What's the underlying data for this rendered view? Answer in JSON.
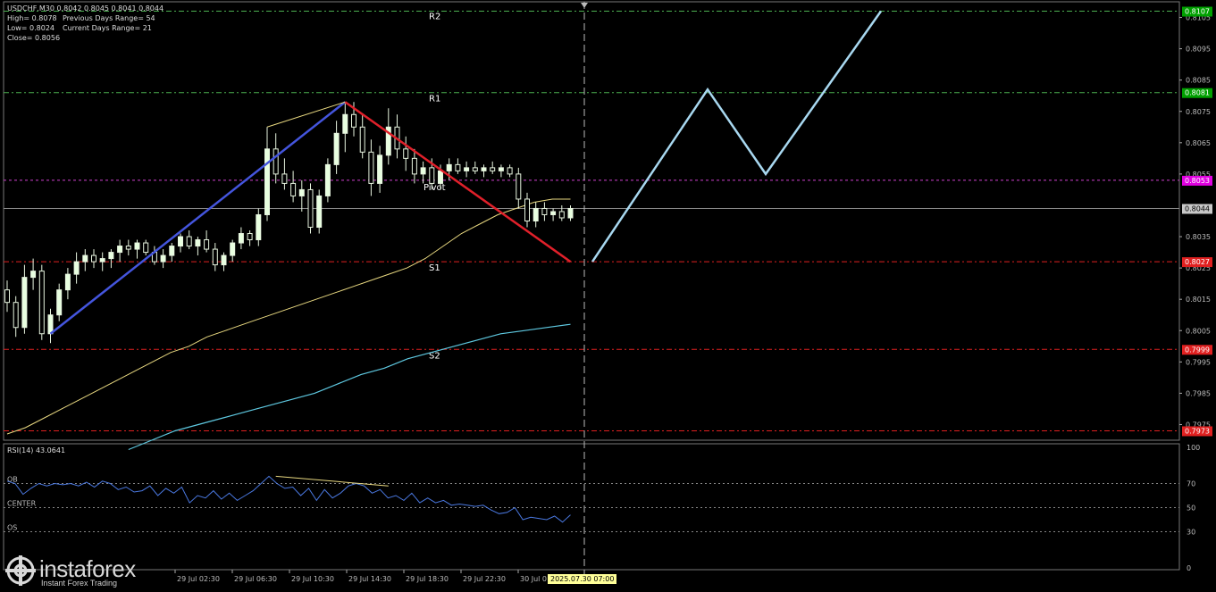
{
  "header": {
    "symbol": "USDCHF,M30",
    "ohlc": "0.8042 0.8045 0.8041 0.8044",
    "high": "High= 0.8078",
    "low": "Low= 0.8024",
    "close": "Close= 0.8056",
    "prev_range": "Previous Days Range= 54",
    "cur_range": "Current Days Range= 21"
  },
  "levels": [
    {
      "id": "R2",
      "label": "R2",
      "value": 0.8107,
      "tag": "0.8107",
      "tag_color": "#00a000",
      "line_color": "#4caf50"
    },
    {
      "id": "R1",
      "label": "R1",
      "value": 0.8081,
      "tag": "0.8081",
      "tag_color": "#00a000",
      "line_color": "#4caf50"
    },
    {
      "id": "Pivot",
      "label": "Pivot",
      "value": 0.8053,
      "tag": "0.8053",
      "tag_color": "#e000e0",
      "line_color": "#d040d0"
    },
    {
      "id": "current",
      "label": "",
      "value": 0.8044,
      "tag": "0.8044",
      "tag_color": "#c8c8c8",
      "line_color": "#888888"
    },
    {
      "id": "S1",
      "label": "S1",
      "value": 0.8027,
      "tag": "0.8027",
      "tag_color": "#e02020",
      "line_color": "#e02020"
    },
    {
      "id": "S2",
      "label": "S2",
      "value": 0.7999,
      "tag": "0.7999",
      "tag_color": "#e02020",
      "line_color": "#e02020"
    },
    {
      "id": "S3",
      "label": "",
      "value": 0.7973,
      "tag": "0.7973",
      "tag_color": "#e02020",
      "line_color": "#e02020"
    }
  ],
  "price_axis": [
    "0.8105",
    "0.8095",
    "0.8085",
    "0.8075",
    "0.8065",
    "0.8055",
    "0.8035",
    "0.8025",
    "0.8015",
    "0.8005",
    "0.7995",
    "0.7985",
    "0.7975"
  ],
  "rsi": {
    "label": "RSI(14) 43.0641",
    "axis": [
      "100",
      "70",
      "50",
      "30",
      "0"
    ],
    "level_labels": {
      "ob": "OB",
      "center": "CENTER",
      "os": "OS"
    },
    "values": [
      72,
      70,
      61,
      66,
      70,
      68,
      70,
      69,
      70,
      68,
      71,
      67,
      72,
      70,
      65,
      67,
      63,
      64,
      68,
      60,
      66,
      62,
      67,
      54,
      60,
      58,
      64,
      57,
      62,
      56,
      60,
      64,
      70,
      76,
      70,
      66,
      67,
      60,
      66,
      56,
      65,
      58,
      62,
      68,
      70,
      68,
      62,
      65,
      58,
      60,
      56,
      62,
      54,
      58,
      54,
      56,
      52,
      53,
      52,
      51,
      52,
      48,
      45,
      46,
      50,
      40,
      42,
      41,
      40,
      43,
      38,
      44
    ]
  },
  "time_axis": [
    "29 Jul 02:30",
    "29 Jul 06:30",
    "29 Jul 10:30",
    "29 Jul 14:30",
    "29 Jul 18:30",
    "29 Jul 22:30",
    "30 Jul 0"
  ],
  "time_cursor": "2025.07.30 07:00",
  "brand": {
    "name": "instaforex",
    "tagline": "Instant Forex Trading"
  },
  "chart_data": {
    "type": "candlestick",
    "symbol": "USDCHF",
    "timeframe": "M30",
    "ylim": [
      0.797,
      0.811
    ],
    "candles": [
      [
        0.8018,
        0.8021,
        0.8011,
        0.8014
      ],
      [
        0.8014,
        0.8016,
        0.8003,
        0.8006
      ],
      [
        0.8006,
        0.8026,
        0.8004,
        0.8022
      ],
      [
        0.8022,
        0.8028,
        0.8018,
        0.8024
      ],
      [
        0.8024,
        0.8026,
        0.8002,
        0.8004
      ],
      [
        0.8004,
        0.8012,
        0.8001,
        0.801
      ],
      [
        0.801,
        0.802,
        0.8008,
        0.8018
      ],
      [
        0.8018,
        0.8025,
        0.8015,
        0.8023
      ],
      [
        0.8023,
        0.803,
        0.802,
        0.8027
      ],
      [
        0.8027,
        0.8031,
        0.8024,
        0.8029
      ],
      [
        0.8029,
        0.8031,
        0.8025,
        0.8027
      ],
      [
        0.8027,
        0.803,
        0.8024,
        0.8028
      ],
      [
        0.8028,
        0.8031,
        0.8025,
        0.803
      ],
      [
        0.803,
        0.8034,
        0.8027,
        0.8032
      ],
      [
        0.8032,
        0.8034,
        0.8029,
        0.8031
      ],
      [
        0.8031,
        0.8034,
        0.8028,
        0.8033
      ],
      [
        0.8033,
        0.8034,
        0.8029,
        0.803
      ],
      [
        0.803,
        0.8032,
        0.8026,
        0.8027
      ],
      [
        0.8027,
        0.8031,
        0.8025,
        0.8029
      ],
      [
        0.8029,
        0.8033,
        0.8027,
        0.8032
      ],
      [
        0.8032,
        0.8036,
        0.803,
        0.8035
      ],
      [
        0.8035,
        0.8037,
        0.8031,
        0.8032
      ],
      [
        0.8032,
        0.8035,
        0.8029,
        0.8034
      ],
      [
        0.8034,
        0.8037,
        0.803,
        0.8031
      ],
      [
        0.8031,
        0.8033,
        0.8024,
        0.8026
      ],
      [
        0.8026,
        0.803,
        0.8024,
        0.8029
      ],
      [
        0.8029,
        0.8034,
        0.8027,
        0.8033
      ],
      [
        0.8033,
        0.8038,
        0.8031,
        0.8036
      ],
      [
        0.8036,
        0.8037,
        0.8032,
        0.8034
      ],
      [
        0.8034,
        0.8044,
        0.8032,
        0.8042
      ],
      [
        0.8042,
        0.807,
        0.804,
        0.8063
      ],
      [
        0.8063,
        0.8068,
        0.8052,
        0.8055
      ],
      [
        0.8055,
        0.806,
        0.805,
        0.8052
      ],
      [
        0.8052,
        0.8056,
        0.8046,
        0.8048
      ],
      [
        0.8048,
        0.8053,
        0.8043,
        0.805
      ],
      [
        0.805,
        0.8052,
        0.8036,
        0.8038
      ],
      [
        0.8038,
        0.805,
        0.8036,
        0.8048
      ],
      [
        0.8048,
        0.806,
        0.8046,
        0.8058
      ],
      [
        0.8058,
        0.8072,
        0.8055,
        0.8068
      ],
      [
        0.8068,
        0.8078,
        0.8062,
        0.8074
      ],
      [
        0.8074,
        0.8078,
        0.8067,
        0.807
      ],
      [
        0.807,
        0.8074,
        0.806,
        0.8062
      ],
      [
        0.8062,
        0.8066,
        0.8048,
        0.8052
      ],
      [
        0.8052,
        0.8064,
        0.8049,
        0.8061
      ],
      [
        0.8061,
        0.8076,
        0.8058,
        0.807
      ],
      [
        0.807,
        0.8074,
        0.806,
        0.8063
      ],
      [
        0.8063,
        0.8067,
        0.8056,
        0.806
      ],
      [
        0.806,
        0.8063,
        0.8052,
        0.8055
      ],
      [
        0.8055,
        0.8059,
        0.8052,
        0.8057
      ],
      [
        0.8057,
        0.806,
        0.805,
        0.8052
      ],
      [
        0.8052,
        0.8058,
        0.805,
        0.8056
      ],
      [
        0.8056,
        0.806,
        0.8053,
        0.8058
      ],
      [
        0.8058,
        0.806,
        0.8055,
        0.8056
      ],
      [
        0.8056,
        0.8059,
        0.8054,
        0.8057
      ],
      [
        0.8057,
        0.8059,
        0.8055,
        0.8056
      ],
      [
        0.8056,
        0.8058,
        0.8054,
        0.8057
      ],
      [
        0.8057,
        0.8059,
        0.8055,
        0.8056
      ],
      [
        0.8056,
        0.8058,
        0.8054,
        0.8057
      ],
      [
        0.8057,
        0.8058,
        0.8054,
        0.8055
      ],
      [
        0.8055,
        0.8057,
        0.8044,
        0.8047
      ],
      [
        0.8047,
        0.8049,
        0.8038,
        0.804
      ],
      [
        0.804,
        0.8046,
        0.8038,
        0.8044
      ],
      [
        0.8044,
        0.8046,
        0.804,
        0.8042
      ],
      [
        0.8042,
        0.8044,
        0.804,
        0.8043
      ],
      [
        0.8043,
        0.8045,
        0.804,
        0.8041
      ],
      [
        0.8041,
        0.8045,
        0.804,
        0.8044
      ]
    ],
    "ma_slow": [
      0.7972,
      0.7974,
      0.7977,
      0.798,
      0.7983,
      0.7986,
      0.7989,
      0.7992,
      0.7995,
      0.7998,
      0.8,
      0.8003,
      0.8005,
      0.8007,
      0.8009,
      0.8011,
      0.8013,
      0.8015,
      0.8017,
      0.8019,
      0.8021,
      0.8023,
      0.8025,
      0.8028,
      0.8032,
      0.8036,
      0.8039,
      0.8042,
      0.8044,
      0.8046,
      0.8047,
      0.8047
    ],
    "ma_long": [
      0.7967,
      0.797,
      0.7973,
      0.7975,
      0.7977,
      0.7979,
      0.7981,
      0.7983,
      0.7985,
      0.7988,
      0.7991,
      0.7993,
      0.7996,
      0.7998,
      0.8,
      0.8002,
      0.8004,
      0.8005,
      0.8006,
      0.8007
    ],
    "trend_lines": [
      {
        "color": "#4455dd",
        "from": [
          5,
          0.8004
        ],
        "to": [
          39,
          0.8078
        ]
      },
      {
        "color": "#e0202a",
        "from": [
          39,
          0.8078
        ],
        "to": [
          65,
          0.8027
        ]
      }
    ],
    "forecast_path": [
      0.8027,
      0.8082,
      0.8055,
      0.8107
    ]
  }
}
